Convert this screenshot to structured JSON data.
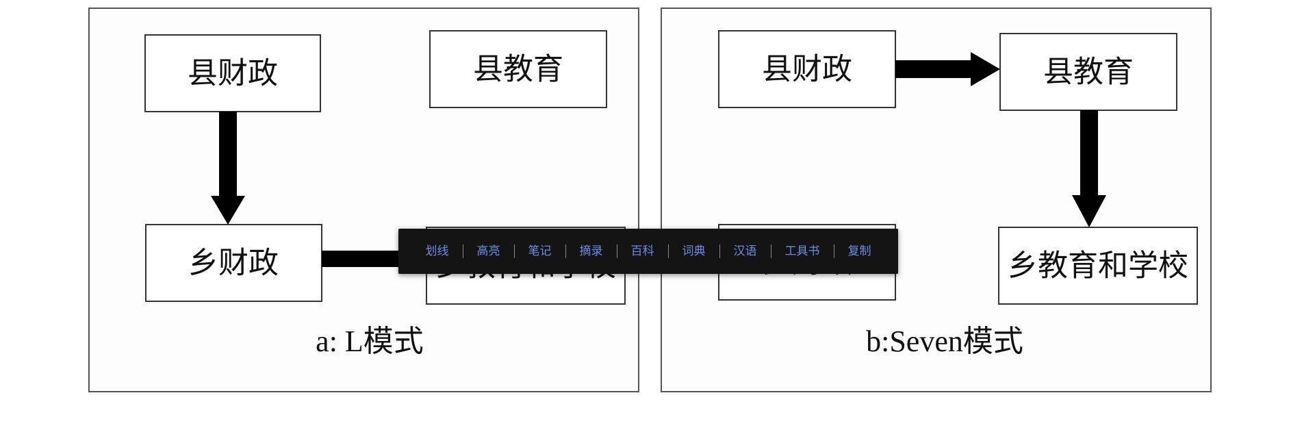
{
  "colors": {
    "toolbar_bg": "#141414",
    "toolbar_text": "#6b8ee6",
    "arrow": "#000000"
  },
  "diagram": {
    "panels": [
      {
        "id": "a",
        "caption": "a: L模式",
        "boxes": [
          {
            "id": "a-county-finance",
            "label": "县财政"
          },
          {
            "id": "a-county-education",
            "label": "县教育"
          },
          {
            "id": "a-township-finance",
            "label": "乡财政"
          },
          {
            "id": "a-township-education",
            "label": "乡教育和学校"
          }
        ],
        "arrows": [
          {
            "from": "a-county-finance",
            "to": "a-township-finance"
          },
          {
            "from": "a-township-finance",
            "to": "a-township-education"
          }
        ]
      },
      {
        "id": "b",
        "caption": "b:Seven模式",
        "boxes": [
          {
            "id": "b-county-finance",
            "label": "县财政"
          },
          {
            "id": "b-county-education",
            "label": "县教育"
          },
          {
            "id": "b-township-finance",
            "label": "乡财政"
          },
          {
            "id": "b-township-education",
            "label": "乡教育和学校"
          }
        ],
        "arrows": [
          {
            "from": "b-county-finance",
            "to": "b-county-education"
          },
          {
            "from": "b-county-education",
            "to": "b-township-education"
          }
        ]
      }
    ]
  },
  "toolbar": {
    "items": [
      {
        "id": "underline",
        "label": "划线"
      },
      {
        "id": "highlight",
        "label": "高亮"
      },
      {
        "id": "note",
        "label": "笔记"
      },
      {
        "id": "excerpt",
        "label": "摘录"
      },
      {
        "id": "encyclopedia",
        "label": "百科"
      },
      {
        "id": "dictionary",
        "label": "词典"
      },
      {
        "id": "chinese",
        "label": "汉语"
      },
      {
        "id": "reference-book",
        "label": "工具书"
      },
      {
        "id": "copy",
        "label": "复制"
      }
    ]
  }
}
